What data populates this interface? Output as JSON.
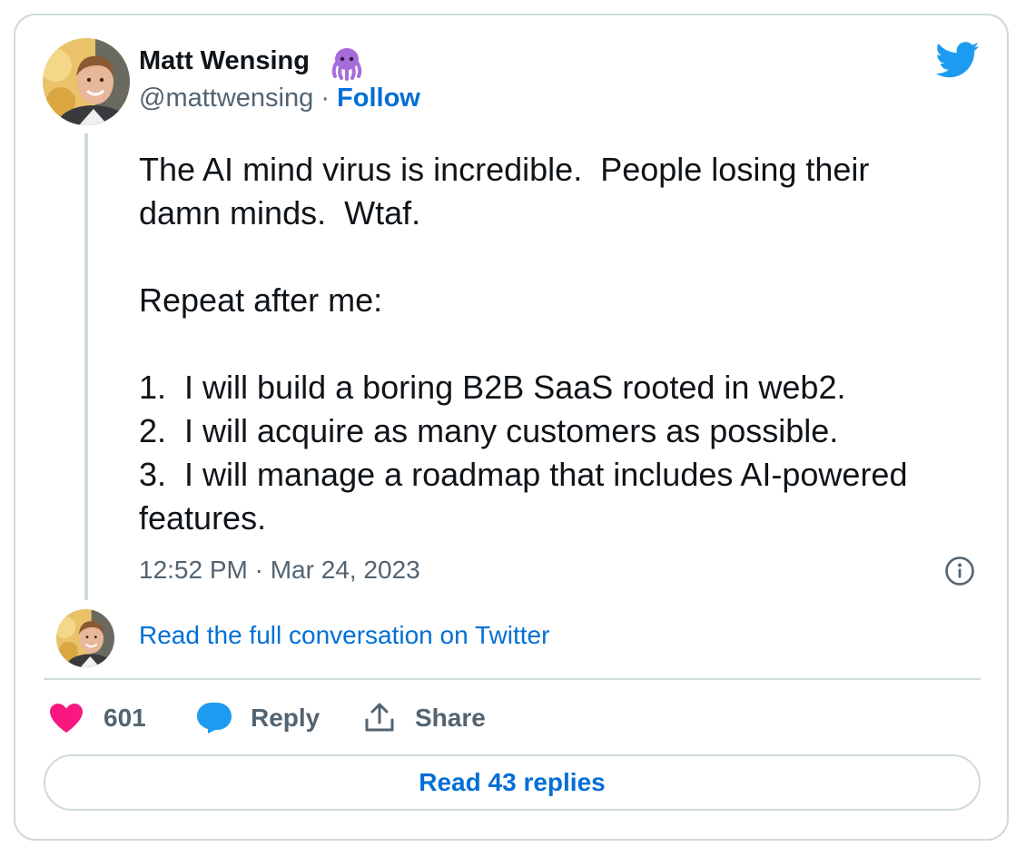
{
  "tweet": {
    "author_name": "Matt Wensing",
    "name_emoji_icon": "octopus-icon",
    "handle": "@mattwensing",
    "separator": "·",
    "follow_label": "Follow",
    "text": "The AI mind virus is incredible.  People losing their\ndamn minds.  Wtaf.\n\nRepeat after me:\n\n1.  I will build a boring B2B SaaS rooted in web2.\n2.  I will acquire as many customers as possible.\n3.  I will manage a roadmap that includes AI-powered\nfeatures.",
    "timestamp": "12:52 PM · Mar 24, 2023"
  },
  "conversation": {
    "link_label": "Read the full conversation on Twitter"
  },
  "actions": {
    "like_count": "601",
    "reply_label": "Reply",
    "share_label": "Share"
  },
  "replies": {
    "button_label": "Read 43 replies"
  },
  "icons": {
    "brand": "twitter-logo-icon",
    "info": "info-icon",
    "like": "heart-icon",
    "reply": "speech-bubble-icon",
    "share": "share-upload-icon"
  },
  "colors": {
    "link_blue": "#006fd6",
    "twitter_blue": "#1d9bf0",
    "heart_pink": "#f91880",
    "muted_text": "#536471",
    "border": "#cfd9de",
    "emoji_purple": "#a66cd9"
  }
}
